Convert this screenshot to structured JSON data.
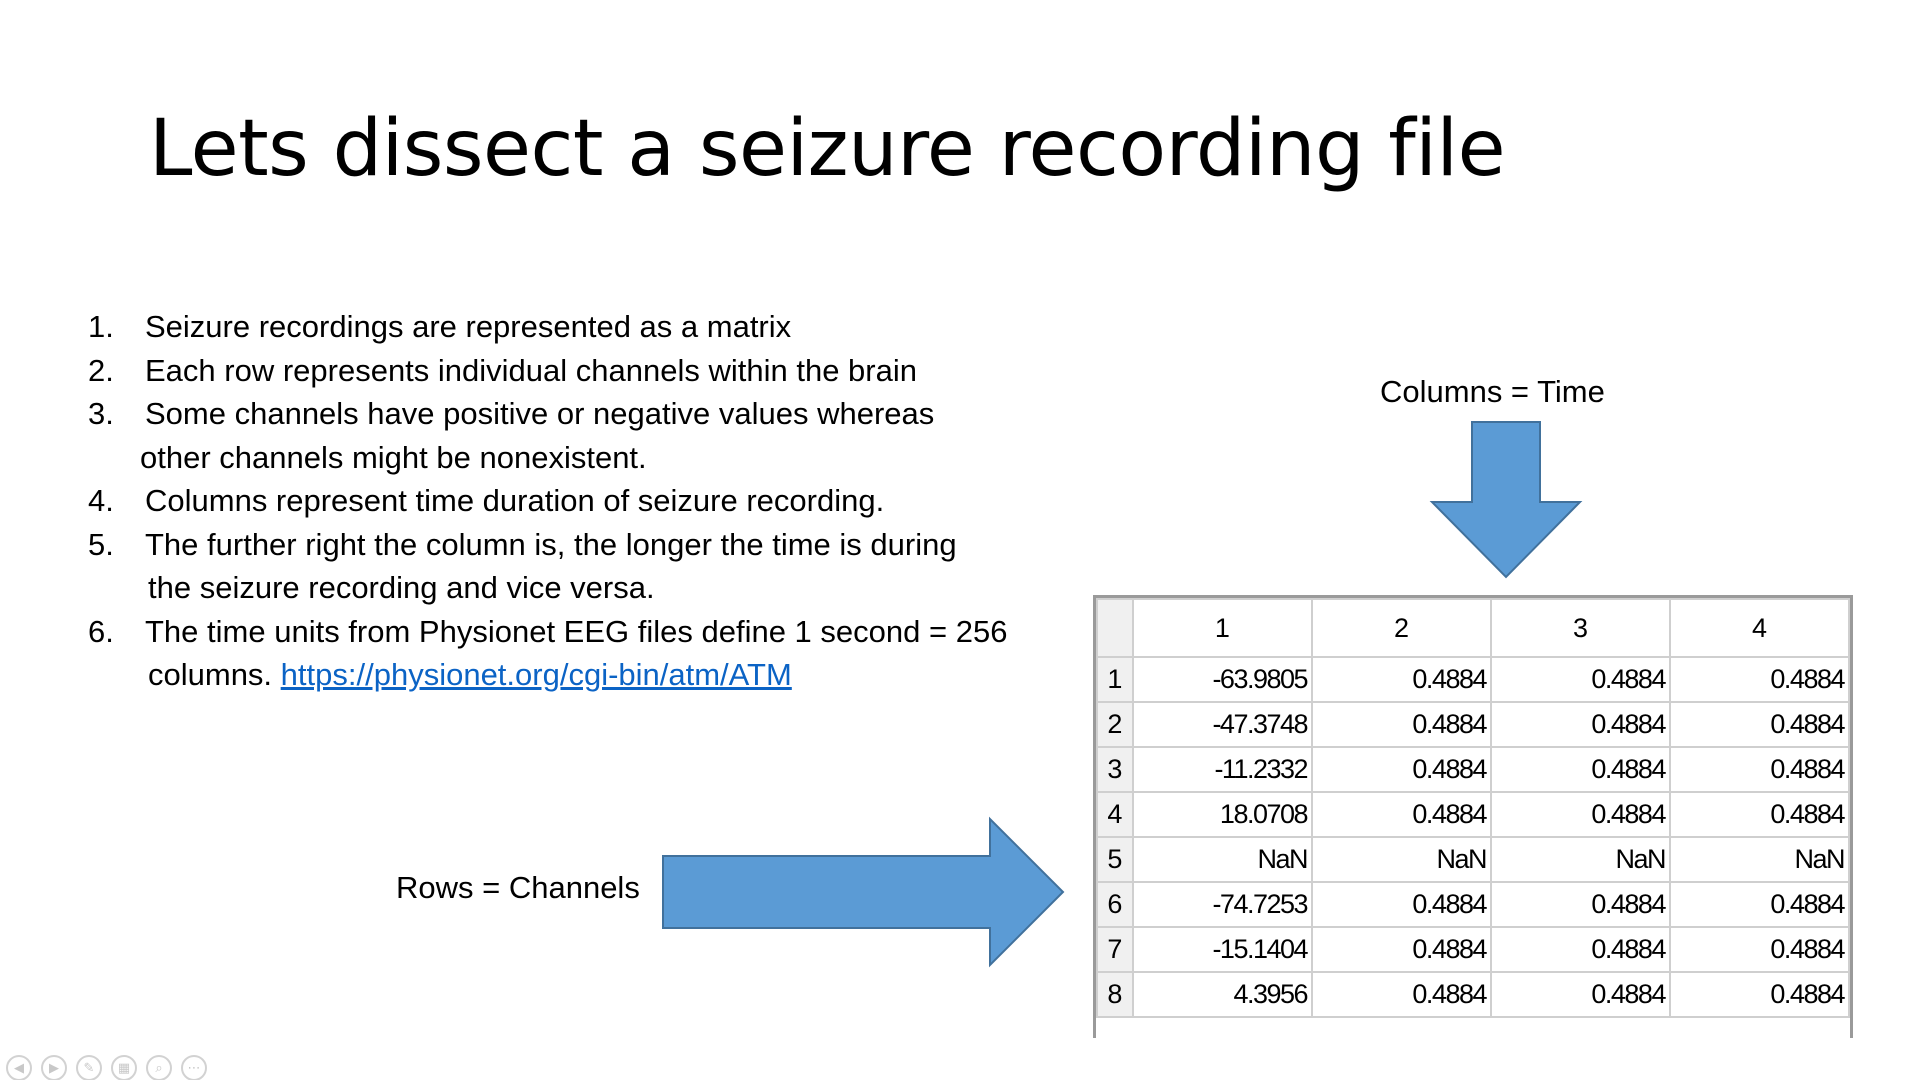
{
  "slide": {
    "title": "Lets dissect a seizure recording file",
    "bullets": [
      {
        "num": "1.",
        "text": "Seizure recordings are represented as a matrix",
        "cont": ""
      },
      {
        "num": "2.",
        "text": "Each row represents individual channels within the brain",
        "cont": ""
      },
      {
        "num": "3.",
        "text": "Some channels have positive or negative values whereas",
        "cont": "other channels might be nonexistent."
      },
      {
        "num": "4.",
        "text": "Columns represent time duration of seizure recording.",
        "cont": ""
      },
      {
        "num": "5.",
        "text": "The further right the column is, the longer the time is during",
        "cont": "the seizure recording and vice versa."
      },
      {
        "num": "6.",
        "text": "The time units from Physionet EEG files define 1 second = 256",
        "cont": "columns. ",
        "link": "https://physionet.org/cgi-bin/atm/ATM"
      }
    ],
    "columns_label": "Columns = Time",
    "rows_label": "Rows = Channels",
    "arrow_color": "#5b9bd5",
    "link_color": "#0b63c5"
  },
  "matrix": {
    "headers": [
      "1",
      "2",
      "3",
      "4"
    ],
    "rows": [
      {
        "label": "1",
        "cells": [
          "-63.9805",
          "0.4884",
          "0.4884",
          "0.4884"
        ]
      },
      {
        "label": "2",
        "cells": [
          "-47.3748",
          "0.4884",
          "0.4884",
          "0.4884"
        ]
      },
      {
        "label": "3",
        "cells": [
          "-11.2332",
          "0.4884",
          "0.4884",
          "0.4884"
        ]
      },
      {
        "label": "4",
        "cells": [
          "18.0708",
          "0.4884",
          "0.4884",
          "0.4884"
        ]
      },
      {
        "label": "5",
        "cells": [
          "NaN",
          "NaN",
          "NaN",
          "NaN"
        ]
      },
      {
        "label": "6",
        "cells": [
          "-74.7253",
          "0.4884",
          "0.4884",
          "0.4884"
        ]
      },
      {
        "label": "7",
        "cells": [
          "-15.1404",
          "0.4884",
          "0.4884",
          "0.4884"
        ]
      },
      {
        "label": "8",
        "cells": [
          "4.3956",
          "0.4884",
          "0.4884",
          "0.4884"
        ]
      }
    ]
  },
  "presentation_controls": [
    {
      "name": "previous-slide-icon",
      "glyph": "◀"
    },
    {
      "name": "next-slide-icon",
      "glyph": "▶"
    },
    {
      "name": "pen-icon",
      "glyph": "✎"
    },
    {
      "name": "slides-grid-icon",
      "glyph": "▦"
    },
    {
      "name": "zoom-icon",
      "glyph": "⌕"
    },
    {
      "name": "more-options-icon",
      "glyph": "⋯"
    }
  ]
}
